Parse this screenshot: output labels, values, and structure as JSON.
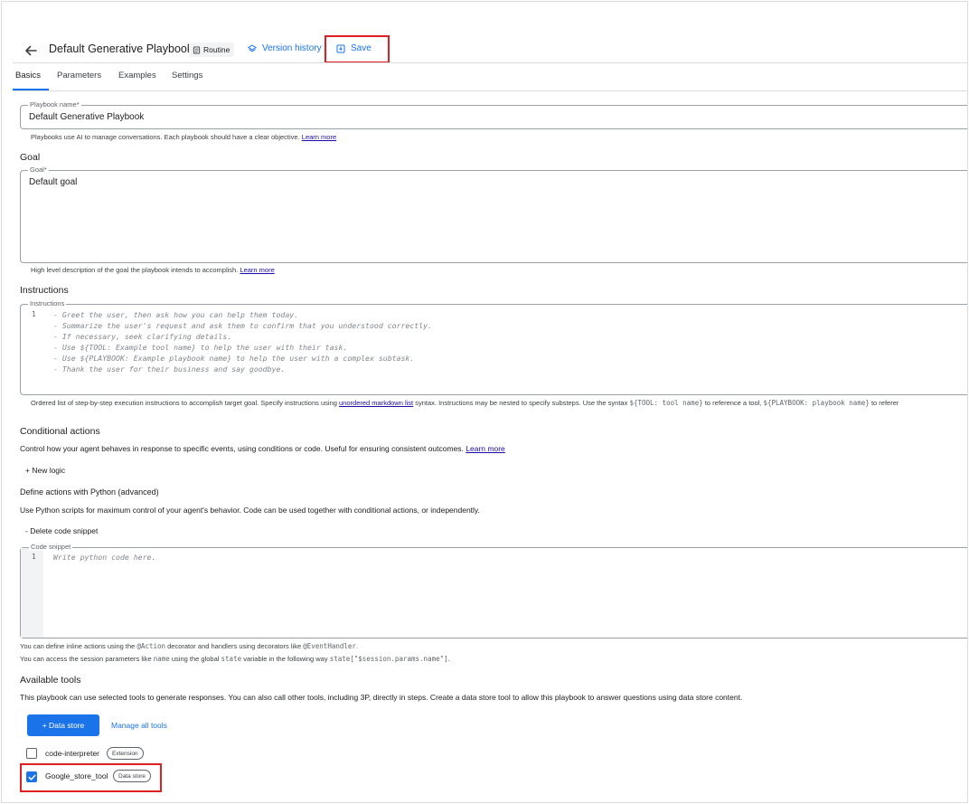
{
  "header": {
    "title": "Default Generative Playbook",
    "chip_label": "Routine",
    "version_history": "Version history",
    "save": "Save"
  },
  "tabs": [
    {
      "label": "Basics"
    },
    {
      "label": "Parameters"
    },
    {
      "label": "Examples"
    },
    {
      "label": "Settings"
    }
  ],
  "playbook_name": {
    "legend": "Playbook name*",
    "value": "Default Generative Playbook",
    "help": "Playbooks use AI to manage conversations. Each playbook should have a clear objective.",
    "learn_more": "Learn more"
  },
  "goal": {
    "heading": "Goal",
    "legend": "Goal*",
    "value": "Default goal",
    "help": "High level description of the goal the playbook intends to accomplish.",
    "learn_more": "Learn more"
  },
  "instructions": {
    "heading": "Instructions",
    "legend": "Instructions",
    "line_number": "1",
    "lines": [
      "- Greet the user, then ask how you can help them today.",
      "- Summarize the user's request and ask them to confirm that you understood correctly.",
      "- If necessary, seek clarifying details.",
      "- Use ${TOOL: Example tool name} to help the user with their task.",
      "- Use ${PLAYBOOK: Example playbook name} to help the user with a complex subtask.",
      "- Thank the user for their business and say goodbye."
    ],
    "help_1": "Ordered list of step-by-step execution instructions to accomplish target goal. Specify instructions using",
    "help_link": "unordered markdown list",
    "help_2": "syntax. Instructions may be nested to specify substeps. Use the syntax",
    "help_code_1": "${TOOL: tool name}",
    "help_3": "to reference a tool,",
    "help_code_2": "${PLAYBOOK: playbook name}",
    "help_4": "to referer"
  },
  "conditional": {
    "heading": "Conditional actions",
    "desc": "Control how your agent behaves in response to specific events, using conditions or code. Useful for ensuring consistent outcomes.",
    "learn_more": "Learn more",
    "new_logic": "+ New logic"
  },
  "python": {
    "heading": "Define actions with Python (advanced)",
    "desc": "Use Python scripts for maximum control of your agent's behavior. Code can be used together with conditional actions, or independently.",
    "delete": "- Delete code snippet",
    "legend": "Code snippet",
    "line_number": "1",
    "placeholder": "Write python code here.",
    "help1_a": "You can define inline actions using the",
    "help1_code1": "@Action",
    "help1_b": "decorator and handlers using decorators like",
    "help1_code2": "@EventHandler",
    "help1_c": ".",
    "help2_a": "You can access the session parameters like",
    "help2_code1": "name",
    "help2_b": "using the global",
    "help2_code2": "state",
    "help2_c": "variable in the following way",
    "help2_code3": "state[\"$session.params.name\"]",
    "help2_d": "."
  },
  "tools": {
    "heading": "Available tools",
    "desc": "This playbook can use selected tools to generate responses. You can also call other tools, including 3P, directly in steps. Create a data store tool to allow this playbook to answer questions using data store content.",
    "data_store_button": "+ Data store",
    "manage": "Manage all tools",
    "items": [
      {
        "name": "code-interpreter",
        "tag": "Extension",
        "checked": false
      },
      {
        "name": "Google_store_tool",
        "tag": "Data store",
        "checked": true
      }
    ]
  },
  "colors": {
    "accent": "#1a73e8",
    "highlight": "#e02020"
  }
}
